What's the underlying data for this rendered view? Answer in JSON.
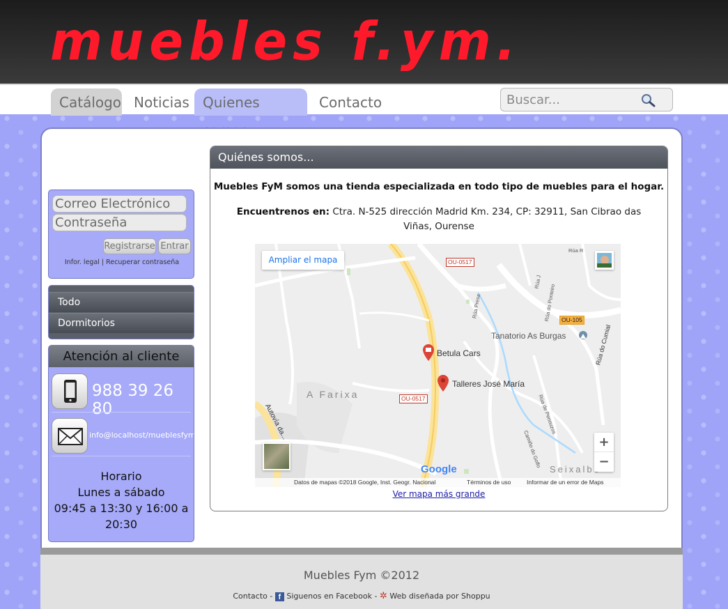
{
  "brand": {
    "logo_text": "muebles f.ym."
  },
  "nav": {
    "tabs": [
      {
        "label": "Catálogo"
      },
      {
        "label": "Noticias"
      },
      {
        "label": "Quienes somos"
      },
      {
        "label": "Contacto"
      }
    ],
    "active": "Quienes somos"
  },
  "search": {
    "placeholder": "Buscar..."
  },
  "login": {
    "email_placeholder": "Correo Electrónico",
    "password_placeholder": "Contraseña",
    "register_label": "Registrarse",
    "enter_label": "Entrar",
    "legal_link": "Infor. legal",
    "separator": "|",
    "recover_link": "Recuperar contraseña"
  },
  "categories": {
    "items": [
      {
        "label": "Todo"
      },
      {
        "label": "Dormitorios"
      }
    ]
  },
  "customer_service": {
    "title": "Atención al cliente",
    "phone": "988 39 26 80",
    "email": "info@localhost/mueblesfym",
    "schedule_title": "Horario",
    "schedule_days": "Lunes a sábado",
    "schedule_hours": "09:45 a 13:30 y 16:00 a 20:30"
  },
  "content": {
    "title": "Quiénes somos...",
    "intro": "Muebles FyM somos una tienda especializada en todo tipo de muebles para el hogar.",
    "address_label": "Encuentrenos en:",
    "address": "Ctra. N-525 dirección Madrid Km. 234, CP: 32911, San Cibrao das Viñas, Ourense"
  },
  "map": {
    "enlarge_button": "Ampliar el mapa",
    "places": {
      "betula": "Betula Cars",
      "talleres": "Talleres José María",
      "tanatorio": "Tanatorio As Burgas",
      "farixa": "A Farixa",
      "seixalbo": "Seixalbo",
      "autovia": "Autovía da...",
      "rua_cumial": "Rúa do Cumial"
    },
    "road_tags": [
      "OU-0517",
      "OU-0517",
      "OU-105"
    ],
    "google_label": "Google",
    "attribution": "Datos de mapas ©2018 Google, Inst. Geogr. Nacional",
    "terms": "Términos de uso",
    "report": "Informar de un error de Maps",
    "zoom_in": "+",
    "zoom_out": "−",
    "bigger_link": "Ver mapa más grande"
  },
  "footer": {
    "copyright": "Muebles Fym ©2012",
    "contact": "Contacto",
    "facebook": "Siguenos en Facebook",
    "designer": "Web diseñada por Shoppu"
  },
  "colors": {
    "logo_red": "#ff1a2b",
    "background_blue": "#9fa4f9",
    "active_tab": "#b9bef9",
    "panel_header": "#5b6068"
  }
}
